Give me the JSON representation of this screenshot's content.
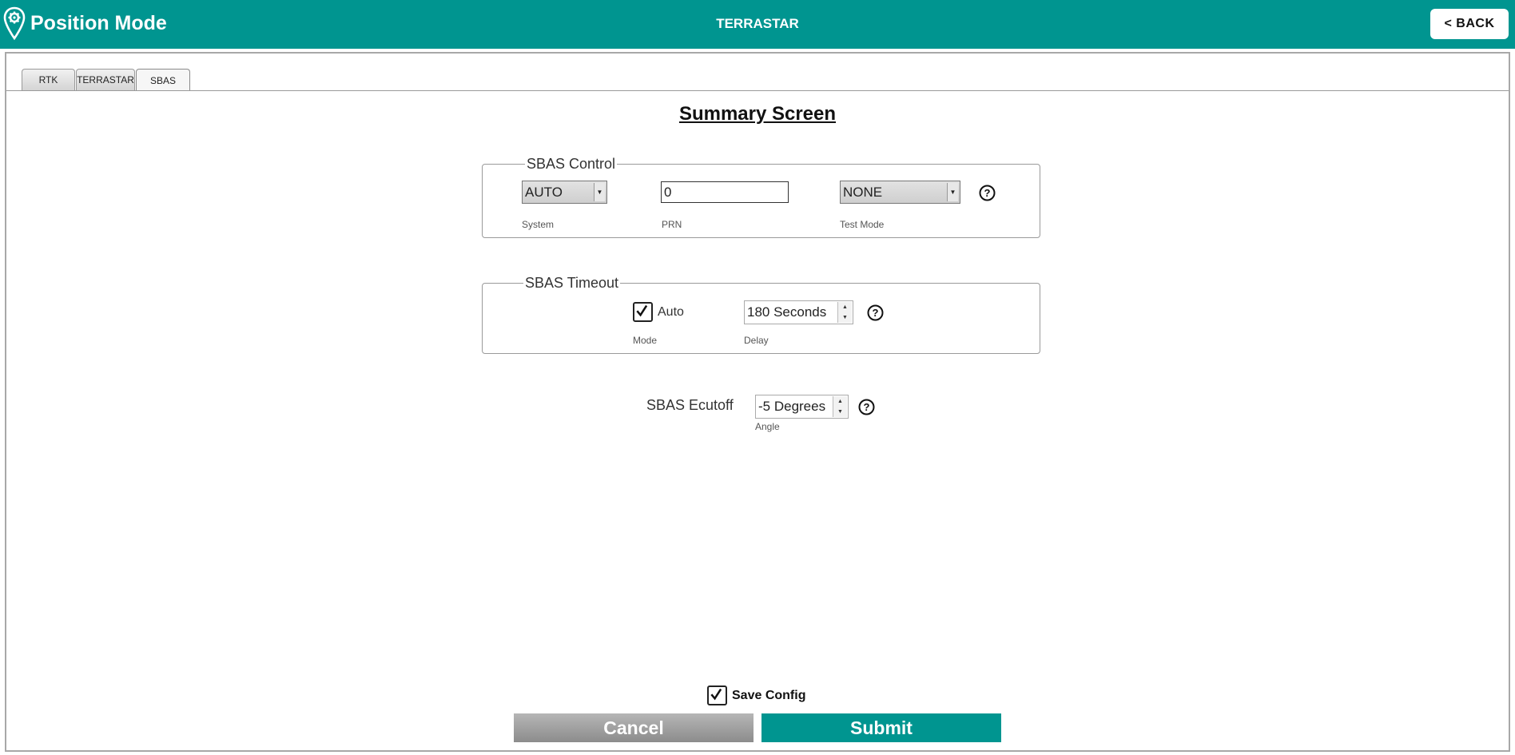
{
  "header": {
    "app_title": "Position Mode",
    "center_title": "TERRASTAR",
    "back_label": "<  BACK"
  },
  "tabs": [
    {
      "label": "RTK"
    },
    {
      "label": "TERRASTAR"
    },
    {
      "label": "SBAS",
      "active": true
    }
  ],
  "summary": {
    "title": "Summary Screen"
  },
  "sbas_control": {
    "legend": "SBAS Control",
    "system": {
      "value": "AUTO",
      "caption": "System"
    },
    "prn": {
      "value": "0",
      "caption": "PRN"
    },
    "test_mode": {
      "value": "NONE",
      "caption": "Test Mode"
    }
  },
  "sbas_timeout": {
    "legend": "SBAS Timeout",
    "mode": {
      "checked": true,
      "label": "Auto",
      "caption": "Mode"
    },
    "delay": {
      "value": "180 Seconds",
      "caption": "Delay"
    }
  },
  "sbas_ecutoff": {
    "label": "SBAS Ecutoff",
    "angle": {
      "value": "-5 Degrees",
      "caption": "Angle"
    }
  },
  "footer": {
    "save_config": {
      "checked": true,
      "label": "Save Config"
    },
    "cancel_label": "Cancel",
    "submit_label": "Submit"
  },
  "colors": {
    "accent": "#009590",
    "cancel_gray": "#a0a0a0"
  },
  "icons": {
    "logo": "location-gear-icon",
    "help": "help-circle-icon",
    "check": "checkmark-icon"
  }
}
